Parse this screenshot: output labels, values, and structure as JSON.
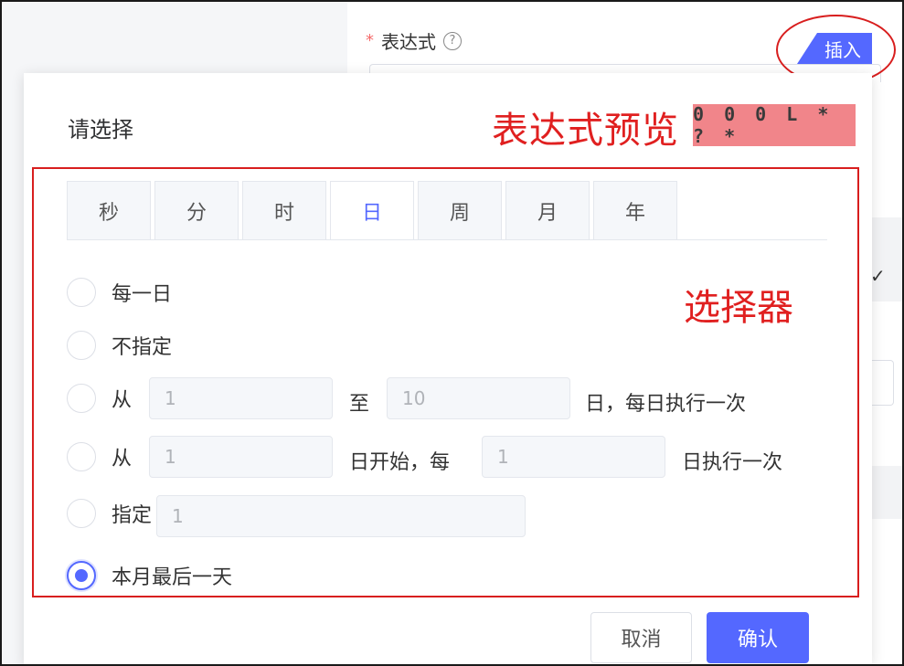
{
  "form": {
    "required_mark": "*",
    "label": "表达式",
    "help_icon_glyph": "?",
    "insert_button": "插入",
    "side_check": "✓"
  },
  "dialog": {
    "title": "请选择",
    "preview_label": "表达式预览",
    "preview_value": "0 0 0 L * ? *",
    "picker_label": "选择器",
    "tabs": [
      {
        "label": "秒"
      },
      {
        "label": "分"
      },
      {
        "label": "时"
      },
      {
        "label": "日",
        "active": true
      },
      {
        "label": "周"
      },
      {
        "label": "月"
      },
      {
        "label": "年"
      }
    ],
    "options": {
      "every_day": "每一日",
      "unspecified": "不指定",
      "range": {
        "from": "从",
        "start": "1",
        "to": "至",
        "end": "10",
        "suffix": "日，每日执行一次"
      },
      "interval": {
        "from": "从",
        "start": "1",
        "mid": "日开始，每",
        "step": "1",
        "suffix": "日执行一次"
      },
      "specify": {
        "label": "指定",
        "value": "1"
      },
      "last_day": "本月最后一天",
      "selected": "last_day"
    },
    "cancel_button": "取消",
    "confirm_button": "确认"
  },
  "colors": {
    "primary": "#5468ff",
    "annotation_red": "#e02020",
    "preview_bg": "#f1858a"
  }
}
